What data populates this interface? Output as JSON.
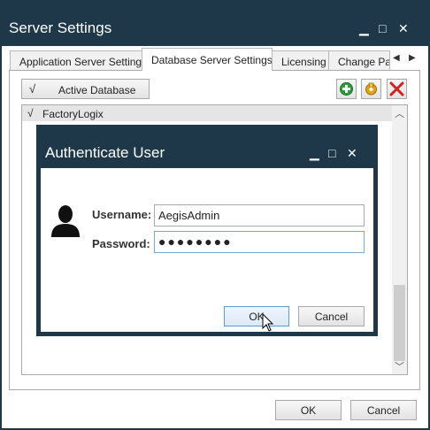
{
  "window": {
    "title": "Server Settings",
    "minimize_glyph": "▁",
    "maximize_glyph": "□",
    "close_glyph": "✕"
  },
  "tabs": [
    {
      "label": "Application Server Settings",
      "active": false
    },
    {
      "label": "Database Server Settings",
      "active": true
    },
    {
      "label": "Licensing",
      "active": false
    },
    {
      "label": "Change Pas",
      "active": false
    }
  ],
  "tab_scroll": {
    "left_glyph": "◀",
    "right_glyph": "▶"
  },
  "toolbar": {
    "active_database_check": "√",
    "active_database_label": "Active Database",
    "add_icon": "add-icon",
    "edit_icon": "edit-icon",
    "delete_icon": "delete-icon"
  },
  "databases": [
    {
      "check": "√",
      "name": "FactoryLogix"
    }
  ],
  "scrollbar": {
    "up_glyph": "︿",
    "down_glyph": "﹀"
  },
  "dialog": {
    "title": "Authenticate User",
    "minimize_glyph": "▁",
    "maximize_glyph": "□",
    "close_glyph": "✕",
    "user_icon": "user-silhouette-icon",
    "username_label": "Username:",
    "username_value": "AegisAdmin",
    "password_label": "Password:",
    "password_value": "●●●●●●●●",
    "ok_label": "OK",
    "cancel_label": "Cancel"
  },
  "footer": {
    "ok_label": "OK",
    "cancel_label": "Cancel"
  },
  "colors": {
    "window_chrome": "#1e3849",
    "add_green": "#2e9a3a",
    "delete_red": "#d0231b",
    "edit_gold": "#e0a31e"
  }
}
